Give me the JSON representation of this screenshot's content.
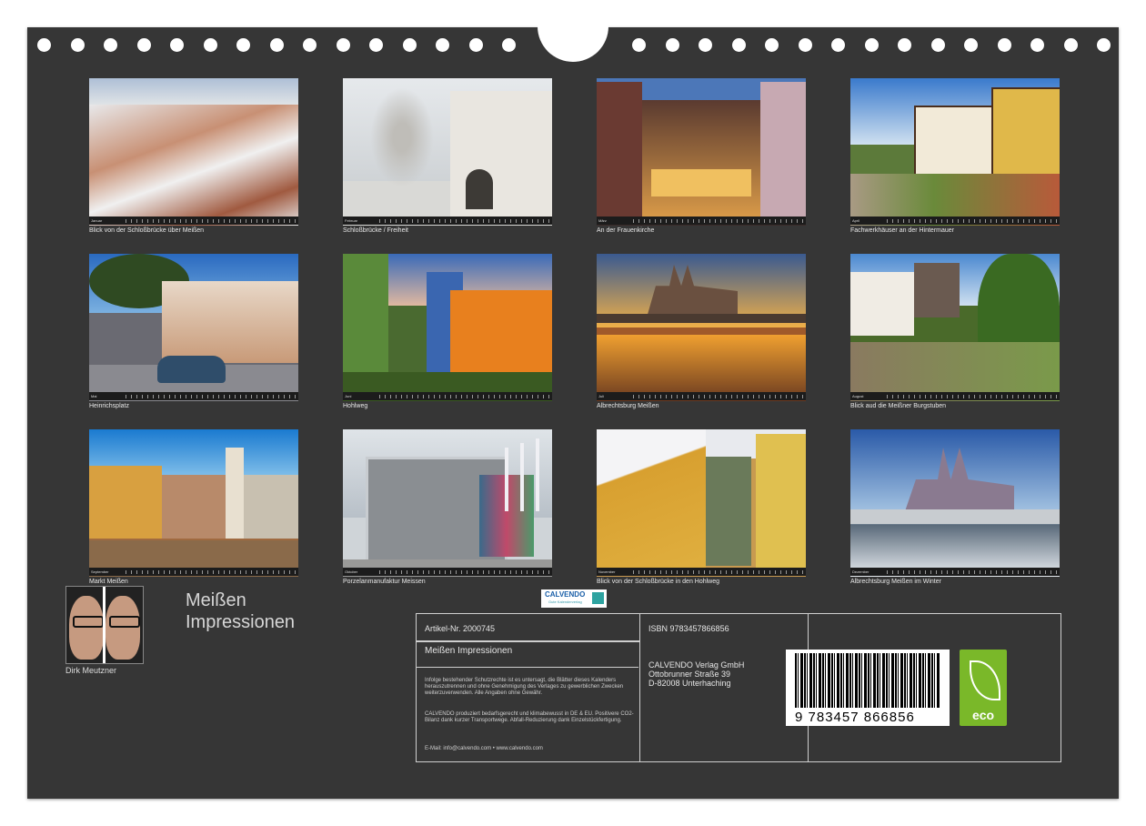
{
  "months": [
    {
      "month": "Januar",
      "caption": "Blick von der Schloßbrücke über Meißen"
    },
    {
      "month": "Februar",
      "caption": "Schloßbrücke / Freiheit"
    },
    {
      "month": "März",
      "caption": "An der Frauenkirche"
    },
    {
      "month": "April",
      "caption": "Fachwerkhäuser an der Hintermauer"
    },
    {
      "month": "Mai",
      "caption": "Heinrichsplatz"
    },
    {
      "month": "Juni",
      "caption": "Hohlweg"
    },
    {
      "month": "Juli",
      "caption": "Albrechtsburg Meißen"
    },
    {
      "month": "August",
      "caption": "Blick aud die Meißner Burgstuben"
    },
    {
      "month": "September",
      "caption": "Markt Meißen"
    },
    {
      "month": "Oktober",
      "caption": "Porzelanmanufaktur Meissen"
    },
    {
      "month": "November",
      "caption": "Blick von der Schloßbrücke in den Hohlweg"
    },
    {
      "month": "Dezember",
      "caption": "Albrechtsburg Meißen im Winter"
    }
  ],
  "author": {
    "name": "Dirk Meutzner"
  },
  "title": {
    "line1": "Meißen",
    "line2": "Impressionen"
  },
  "info": {
    "article": "Artikel-Nr. 2000745",
    "logo": "CALVENDO",
    "logo_sub": "Gute Kalenderverlag",
    "product": "Meißen Impressionen",
    "legal1": "Infolge bestehender Schutzrechte ist es untersagt, die Blätter dieses Kalenders herauszutrennen und ohne Genehmigung des Verlages zu gewerblichen Zwecken weiterzuverwenden. Alle Angaben ohne Gewähr.",
    "legal2": "CALVENDO produziert bedarfsgerecht und klimabewusst in DE & EU. Positivere CO2-Bilanz dank kurzer Transportwege. Abfall-Reduzierung dank Einzelstückfertigung.",
    "email": "E-Mail: info@calvendo.com • www.calvendo.com",
    "isbn": "ISBN 9783457866856",
    "publisher1": "CALVENDO Verlag GmbH",
    "publisher2": "Ottobrunner Straße 39",
    "publisher3": "D-82008 Unterhaching",
    "barcode_number": "9 783457 866856",
    "eco": "eco"
  }
}
